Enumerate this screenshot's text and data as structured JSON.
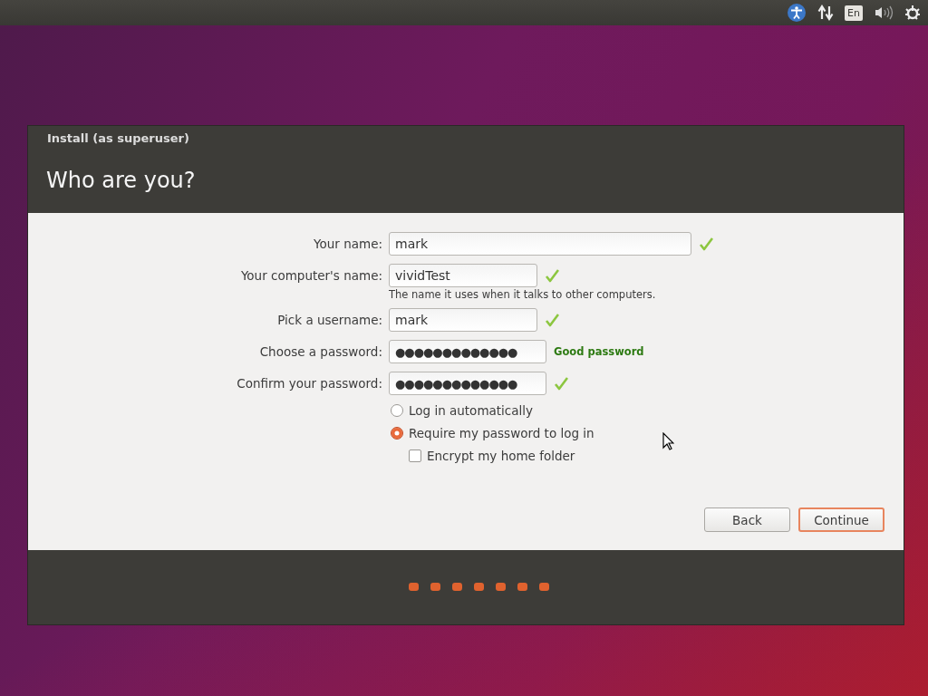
{
  "top_panel": {
    "keyboard_layout": "En"
  },
  "window": {
    "title": "Install (as superuser)",
    "heading": "Who are you?"
  },
  "fields": [
    {
      "label": "Your name:",
      "value": "mark",
      "kind": "text",
      "valid": true
    },
    {
      "label": "Your computer's name:",
      "value": "vividTest",
      "kind": "text",
      "valid": true,
      "hint": "The name it uses when it talks to other computers."
    },
    {
      "label": "Pick a username:",
      "value": "mark",
      "kind": "text",
      "valid": true
    },
    {
      "label": "Choose a password:",
      "value": "●●●●●●●●●●●●●",
      "kind": "password",
      "valid": false,
      "strength": "Good password"
    },
    {
      "label": "Confirm your password:",
      "value": "●●●●●●●●●●●●●",
      "kind": "password",
      "valid": true
    }
  ],
  "login_options": [
    {
      "label": "Log in automatically",
      "selected": false
    },
    {
      "label": "Require my password to log in",
      "selected": true
    }
  ],
  "encrypt": {
    "label": "Encrypt my home folder",
    "checked": false
  },
  "buttons": [
    {
      "label": "Back",
      "default": false
    },
    {
      "label": "Continue",
      "default": true
    }
  ]
}
